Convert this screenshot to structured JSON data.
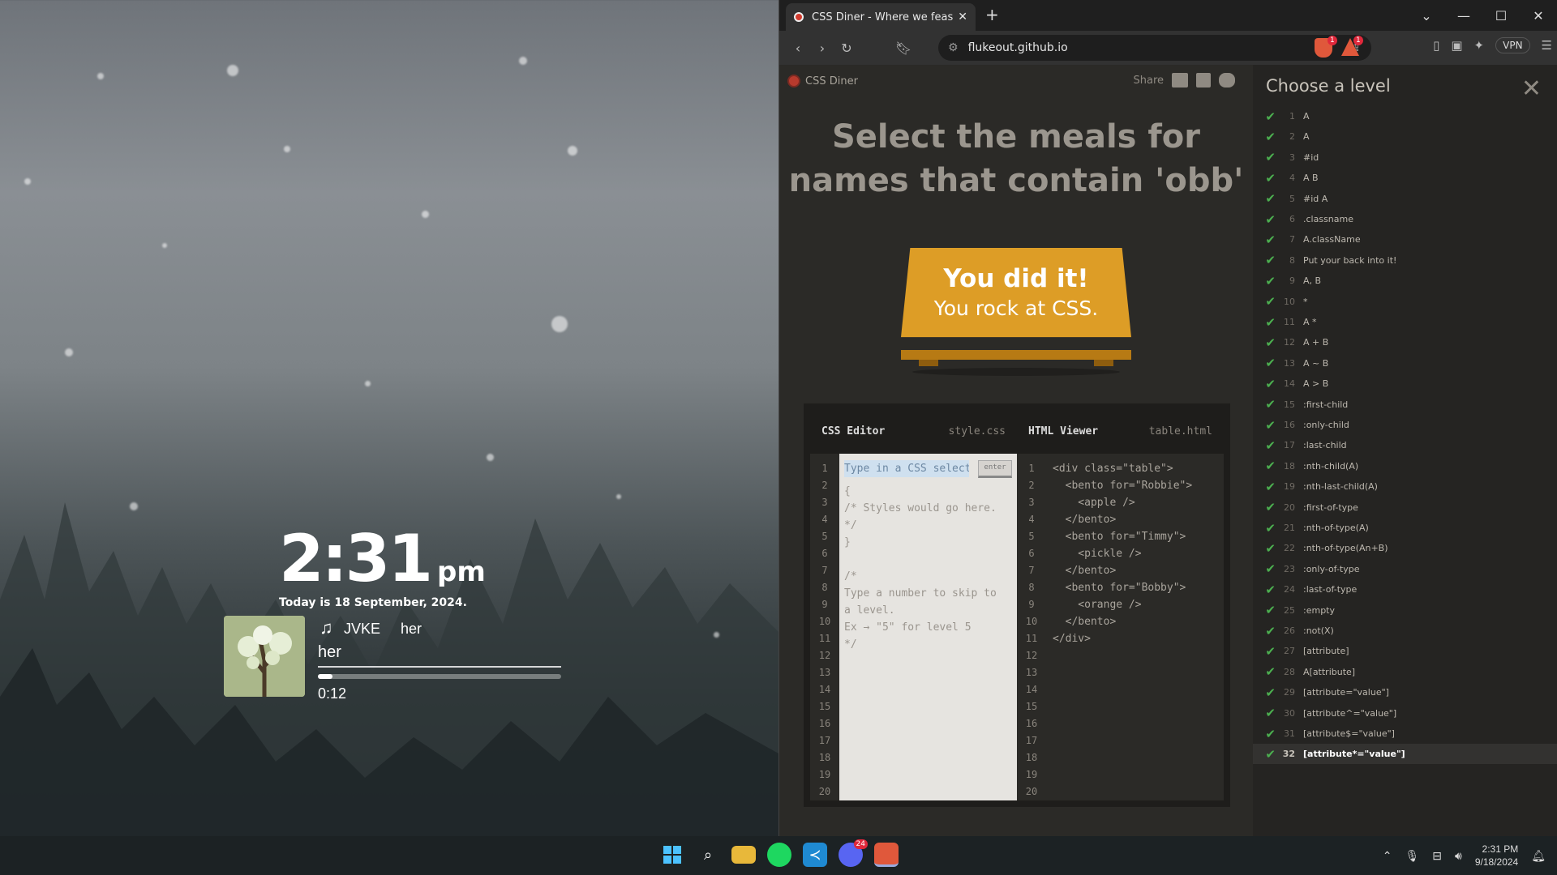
{
  "desktop": {
    "clock": {
      "time": "2:31",
      "ampm": "pm",
      "date": "Today is 18 September, 2024."
    },
    "music": {
      "artist": "JVKE",
      "album": "her",
      "title": "her",
      "elapsed": "0:12",
      "progress": 0.06
    }
  },
  "browser": {
    "tab_title": "CSS Diner - Where we feast on",
    "url": "flukeout.github.io",
    "vpn_label": "VPN",
    "brave_badge": "1",
    "rewards_badge": "1"
  },
  "page": {
    "logo": "CSS Diner",
    "share": "Share",
    "instruction": "Select the meals for names that contain 'obb'",
    "success": {
      "line1": "You did it!",
      "line2": "You rock at CSS."
    },
    "css_editor": {
      "title": "CSS Editor",
      "file": "style.css",
      "placeholder": "Type in a CSS selector",
      "enter_label": "enter",
      "lines": [
        "{",
        "/* Styles would go here. */",
        "}",
        "",
        "/*",
        "Type a number to skip to",
        "a level.",
        "Ex → \"5\" for level 5",
        "*/"
      ]
    },
    "html_viewer": {
      "title": "HTML Viewer",
      "file": "table.html",
      "lines": [
        "<div class=\"table\">",
        "  <bento for=\"Robbie\">",
        "    <apple />",
        "  </bento>",
        "  <bento for=\"Timmy\">",
        "    <pickle />",
        "  </bento>",
        "  <bento for=\"Bobby\">",
        "    <orange />",
        "  </bento>",
        "</div>"
      ]
    },
    "line_numbers": [
      "1",
      "2",
      "3",
      "4",
      "5",
      "6",
      "7",
      "8",
      "9",
      "10",
      "11",
      "12",
      "13",
      "14",
      "15",
      "16",
      "17",
      "18",
      "19",
      "20"
    ]
  },
  "levels": {
    "heading": "Choose a level",
    "items": [
      {
        "num": "1",
        "label": "A"
      },
      {
        "num": "2",
        "label": "A"
      },
      {
        "num": "3",
        "label": "#id"
      },
      {
        "num": "4",
        "label": "A B"
      },
      {
        "num": "5",
        "label": "#id A"
      },
      {
        "num": "6",
        "label": ".classname"
      },
      {
        "num": "7",
        "label": "A.className"
      },
      {
        "num": "8",
        "label": "Put your back into it!"
      },
      {
        "num": "9",
        "label": "A, B"
      },
      {
        "num": "10",
        "label": "*"
      },
      {
        "num": "11",
        "label": "A *"
      },
      {
        "num": "12",
        "label": "A + B"
      },
      {
        "num": "13",
        "label": "A ~ B"
      },
      {
        "num": "14",
        "label": "A > B"
      },
      {
        "num": "15",
        "label": ":first-child"
      },
      {
        "num": "16",
        "label": ":only-child"
      },
      {
        "num": "17",
        "label": ":last-child"
      },
      {
        "num": "18",
        "label": ":nth-child(A)"
      },
      {
        "num": "19",
        "label": ":nth-last-child(A)"
      },
      {
        "num": "20",
        "label": ":first-of-type"
      },
      {
        "num": "21",
        "label": ":nth-of-type(A)"
      },
      {
        "num": "22",
        "label": ":nth-of-type(An+B)"
      },
      {
        "num": "23",
        "label": ":only-of-type"
      },
      {
        "num": "24",
        "label": ":last-of-type"
      },
      {
        "num": "25",
        "label": ":empty"
      },
      {
        "num": "26",
        "label": ":not(X)"
      },
      {
        "num": "27",
        "label": "[attribute]"
      },
      {
        "num": "28",
        "label": "A[attribute]"
      },
      {
        "num": "29",
        "label": "[attribute=\"value\"]"
      },
      {
        "num": "30",
        "label": "[attribute^=\"value\"]"
      },
      {
        "num": "31",
        "label": "[attribute$=\"value\"]"
      },
      {
        "num": "32",
        "label": "[attribute*=\"value\"]"
      }
    ],
    "current": "32"
  },
  "taskbar": {
    "time": "2:31 PM",
    "date": "9/18/2024",
    "discord_badge": "24",
    "icons": [
      "windows-start-icon",
      "search-icon",
      "file-explorer-icon",
      "spotify-icon",
      "vscode-icon",
      "discord-icon",
      "brave-icon"
    ]
  },
  "colors": {
    "accent": "#dd9d26",
    "check": "#4caf50"
  }
}
